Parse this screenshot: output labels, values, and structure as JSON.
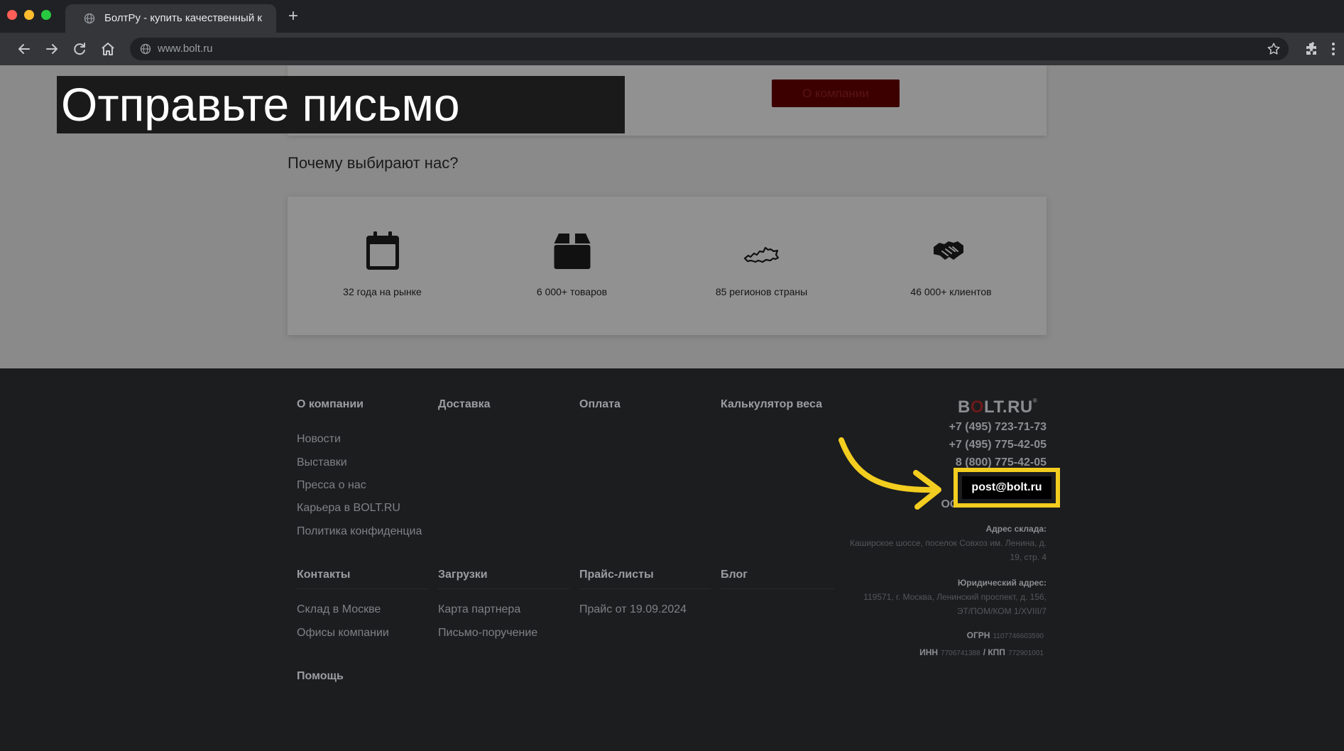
{
  "browser": {
    "tab_title": "БолтРу - купить качественный к",
    "new_tab": "+",
    "url": "www.bolt.ru"
  },
  "overlay": {
    "caption": "Отправьте письмо"
  },
  "about_section": {
    "button_label": "О компании"
  },
  "why_us": {
    "title": "Почему выбирают нас?",
    "stats": [
      {
        "icon": "calendar-icon",
        "label": "32 года на рынке"
      },
      {
        "icon": "box-icon",
        "label": "6 000+ товаров"
      },
      {
        "icon": "russia-map-icon",
        "label": "85 регионов страны"
      },
      {
        "icon": "handshake-icon",
        "label": "46 000+ клиентов"
      }
    ]
  },
  "footer": {
    "col_about": {
      "heading": "О компании",
      "links": [
        "Новости",
        "Выставки",
        "Пресса о нас",
        "Карьера в BOLT.RU",
        "Политика конфиденциа"
      ]
    },
    "col_delivery": {
      "heading": "Доставка"
    },
    "col_payment": {
      "heading": "Оплата"
    },
    "col_calculator": {
      "heading": "Калькулятор веса"
    },
    "col_contacts": {
      "heading": "Контакты",
      "links": [
        "Склад в Москве",
        "Офисы компании"
      ]
    },
    "col_downloads": {
      "heading": "Загрузки",
      "links": [
        "Карта партнера",
        "Письмо-поручение"
      ]
    },
    "col_prices": {
      "heading": "Прайс-листы",
      "links": [
        "Прайс от 19.09.2024"
      ]
    },
    "col_blog": {
      "heading": "Блог"
    },
    "help": "Помощь",
    "contact": {
      "logo_before": "B",
      "logo_o": "O",
      "logo_after": "LT.RU",
      "logo_reg": "®",
      "phone_1": "+7 (495) 723-71-73",
      "phone_2": "+7 (495) 775-42-05",
      "phone_3": "8 (800) 775-42-05",
      "email": "post@bolt.ru",
      "company": "ООО \"ТК БОЛТ.РУ\"",
      "warehouse_label": "Адрес склада:",
      "warehouse_address": "Каширское шоссе, поселок Совхоз им. Ленина, д. 19, стр. 4",
      "legal_label": "Юридический адрес:",
      "legal_address": "119571, г. Москва, Ленинский проспект, д. 156, ЭТ/ПОМ/КОМ 1/XVIII/7",
      "ogrn_label": "ОГРН",
      "ogrn": "1107746603590",
      "inn_label": "ИНН",
      "inn": "7706741388",
      "kpp_label": "/ КПП",
      "kpp": "772901001"
    }
  },
  "colors": {
    "highlight": "#f3cd1f",
    "footer_bg": "#1c1d1f",
    "dimmed_page": "#8a8a8a"
  }
}
